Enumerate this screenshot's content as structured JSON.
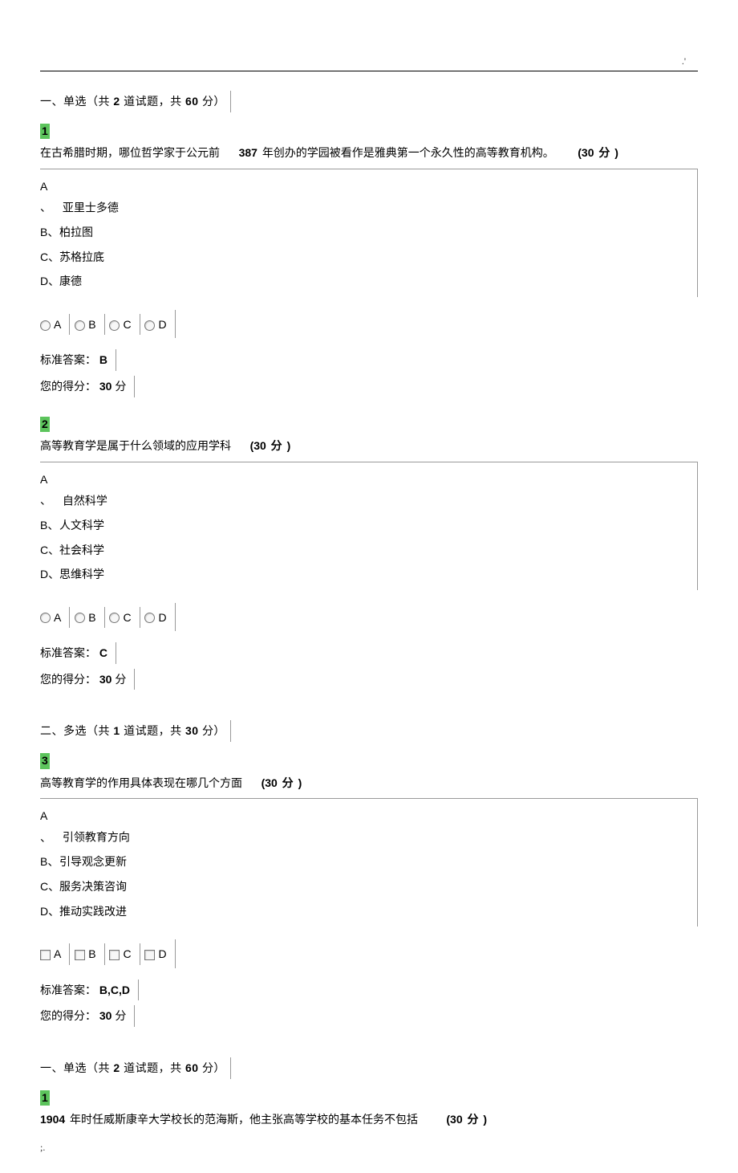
{
  "marks": {
    "top": ".'",
    "bottom": ";."
  },
  "sectionA1": {
    "header_pre": "一、单选（共",
    "header_num": "2",
    "header_mid": "道试题，共",
    "header_pts": "60",
    "header_post": "分）"
  },
  "q1": {
    "num": "1",
    "text_a": "在古希腊时期，哪位哲学家于公元前",
    "text_b": "387",
    "text_c": "年创办的学园被看作是雅典第一个永久性的高等教育机构。",
    "pts": "(30 分 )",
    "optA": "亚里士多德",
    "optB": "柏拉图",
    "optC": "苏格拉底",
    "optD": "康德",
    "ans_label": "标准答案：",
    "ans": "B",
    "score_label": "您的得分：",
    "score_val": "30",
    "score_unit": "分"
  },
  "q2": {
    "num": "2",
    "text": "高等教育学是属于什么领域的应用学科",
    "pts": "(30 分 )",
    "optA": "自然科学",
    "optB": "人文科学",
    "optC": "社会科学",
    "optD": "思维科学",
    "ans_label": "标准答案：",
    "ans": "C",
    "score_label": "您的得分：",
    "score_val": "30",
    "score_unit": "分"
  },
  "sectionB": {
    "header_pre": "二、多选（共",
    "header_num": "1",
    "header_mid": "道试题，共",
    "header_pts": "30",
    "header_post": "分）"
  },
  "q3": {
    "num": "3",
    "text": "高等教育学的作用具体表现在哪几个方面",
    "pts": "(30 分 )",
    "optA": "引领教育方向",
    "optB": "引导观念更新",
    "optC": "服务决策咨询",
    "optD": "推动实践改进",
    "ans_label": "标准答案：",
    "ans": "B,C,D",
    "score_label": "您的得分：",
    "score_val": "30",
    "score_unit": "分"
  },
  "sectionA2": {
    "header_pre": "一、单选（共",
    "header_num": "2",
    "header_mid": "道试题，共",
    "header_pts": "60",
    "header_post": "分）"
  },
  "q4": {
    "num": "1",
    "text_a": "1904",
    "text_b": "年时任威斯康辛大学校长的范海斯，他主张高等学校的基本任务不包括",
    "pts": "(30 分 )"
  },
  "letters": {
    "A": "A",
    "B": "B",
    "C": "C",
    "D": "D"
  },
  "choice_prefix": {
    "A": "A 、",
    "B": "B、",
    "C": "C、",
    "D": "D、"
  }
}
